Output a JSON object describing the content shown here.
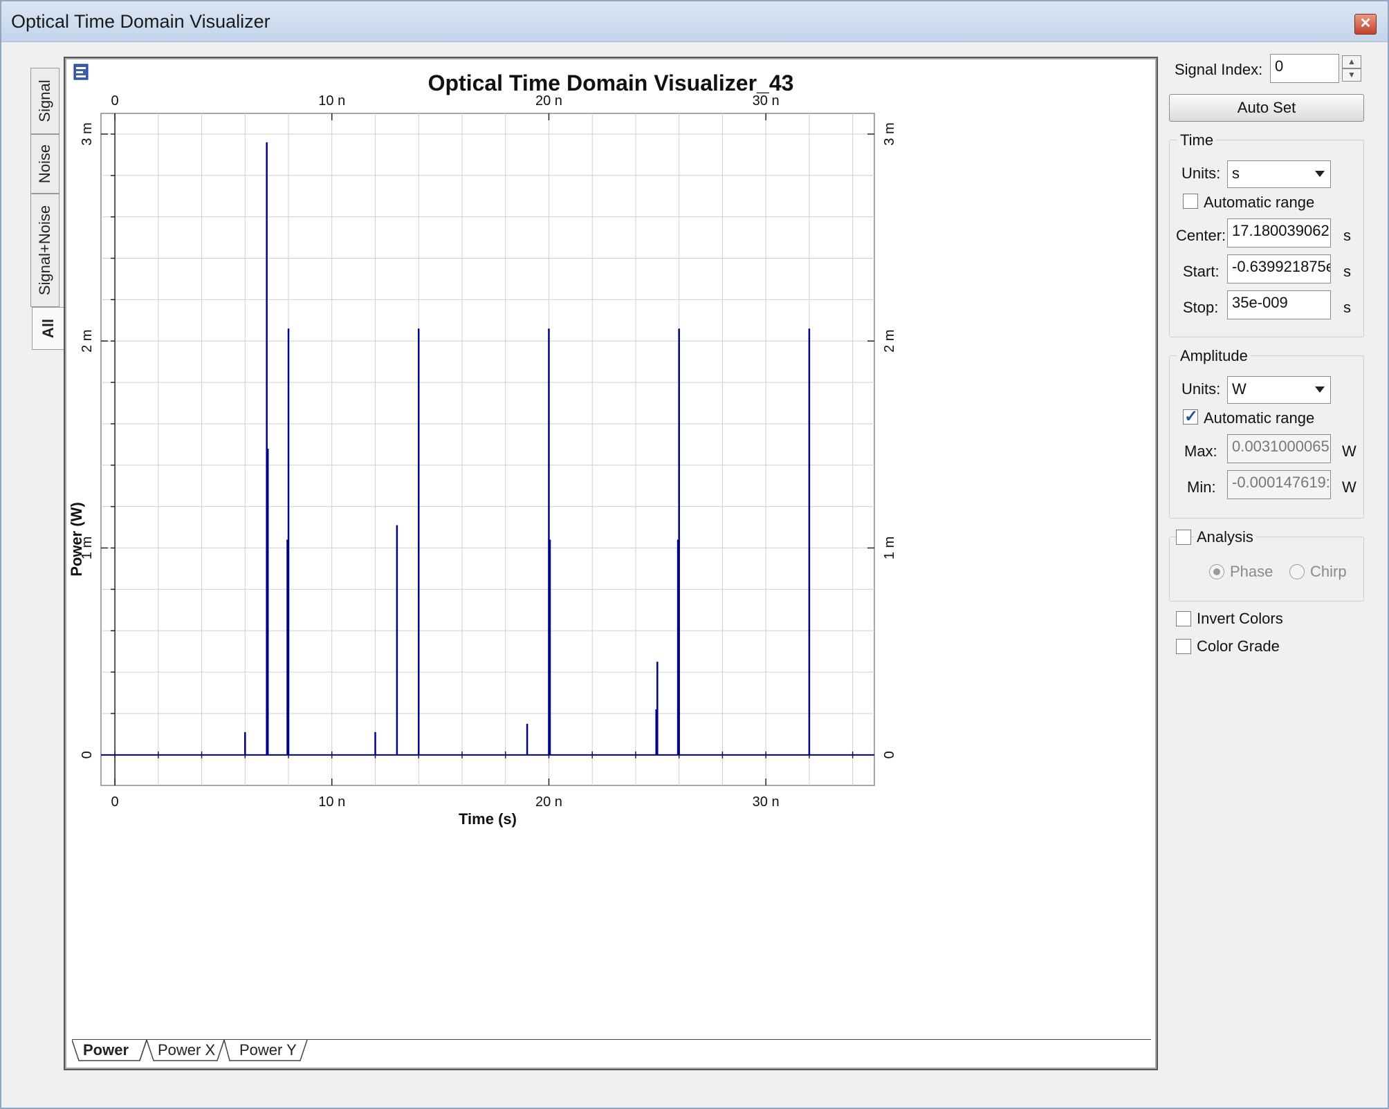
{
  "window": {
    "title": "Optical Time Domain Visualizer",
    "close_glyph": "✕"
  },
  "side_tabs": [
    {
      "label": "Signal"
    },
    {
      "label": "Noise"
    },
    {
      "label": "Signal+Noise"
    },
    {
      "label": "All",
      "active": true
    }
  ],
  "bottom_tabs": [
    {
      "label": "Power",
      "active": true
    },
    {
      "label": "Power X"
    },
    {
      "label": "Power Y"
    }
  ],
  "panel": {
    "signal_index_label": "Signal Index:",
    "signal_index_value": "0",
    "auto_set_label": "Auto Set",
    "time": {
      "title": "Time",
      "units_label": "Units:",
      "units_value": "s",
      "automatic_range_label": "Automatic range",
      "automatic_range_checked": false,
      "center_label": "Center:",
      "center_value": "17.180039062",
      "start_label": "Start:",
      "start_value": "-0.639921875e",
      "stop_label": "Stop:",
      "stop_value": "35e-009",
      "unit_suffix": "s"
    },
    "amplitude": {
      "title": "Amplitude",
      "units_label": "Units:",
      "units_value": "W",
      "automatic_range_label": "Automatic range",
      "automatic_range_checked": true,
      "max_label": "Max:",
      "max_value": "0.0031000065",
      "min_label": "Min:",
      "min_value": "-0.000147619:",
      "unit_suffix": "W"
    },
    "analysis": {
      "title": "Analysis",
      "checked": false,
      "phase_label": "Phase",
      "chirp_label": "Chirp",
      "selected": "Phase"
    },
    "invert_colors_label": "Invert Colors",
    "color_grade_label": "Color Grade"
  },
  "chart_data": {
    "type": "line",
    "title": "Optical Time Domain Visualizer_43",
    "xlabel": "Time (s)",
    "ylabel": "Power (W)",
    "xlim": [
      -6.4e-10,
      3.5e-08
    ],
    "ylim": [
      -0.000147619,
      0.0031000065
    ],
    "x_ticks": [
      0,
      1e-08,
      2e-08,
      3e-08
    ],
    "x_tick_labels": [
      "0",
      "10 n",
      "20 n",
      "30 n"
    ],
    "y_ticks": [
      0,
      0.001,
      0.002,
      0.003
    ],
    "y_tick_labels": [
      "0",
      "1 m",
      "2 m",
      "3 m"
    ],
    "grid": true,
    "line_color": "#00008b",
    "series": [
      {
        "pulses": [
          {
            "t": 6e-09,
            "p": 0.00011
          },
          {
            "t": 7e-09,
            "p": 0.00296
          },
          {
            "t": 7.05e-09,
            "p": 0.00148
          },
          {
            "t": 7.95e-09,
            "p": 0.00104
          },
          {
            "t": 8e-09,
            "p": 0.00206
          },
          {
            "t": 1.2e-08,
            "p": 0.00011
          },
          {
            "t": 1.3e-08,
            "p": 0.00111
          },
          {
            "t": 1.4e-08,
            "p": 0.00206
          },
          {
            "t": 1.9e-08,
            "p": 0.00015
          },
          {
            "t": 2e-08,
            "p": 0.00206
          },
          {
            "t": 2.005e-08,
            "p": 0.00104
          },
          {
            "t": 2.5e-08,
            "p": 0.00045
          },
          {
            "t": 2.495e-08,
            "p": 0.00022
          },
          {
            "t": 2.6e-08,
            "p": 0.00206
          },
          {
            "t": 2.595e-08,
            "p": 0.00104
          },
          {
            "t": 3.2e-08,
            "p": 0.00206
          }
        ]
      }
    ]
  }
}
